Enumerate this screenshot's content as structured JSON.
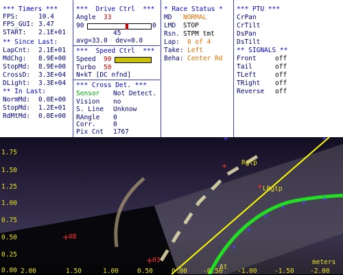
{
  "timers": {
    "header": "*** Timers ***",
    "rows": [
      {
        "label": "FPS:",
        "value": "10.4"
      },
      {
        "label": "FPS_GUI:",
        "value": "3.47"
      },
      {
        "label": "START:",
        "value": "2.1E+01"
      }
    ],
    "since_header": "** Since Last:",
    "since_rows": [
      {
        "label": "LapCnt:",
        "value": "2.1E+01"
      },
      {
        "label": "MdChg:",
        "value": "8.9E+00"
      },
      {
        "label": "StopMd:",
        "value": "8.9E+00"
      },
      {
        "label": "CrossD:",
        "value": "3.3E+04"
      },
      {
        "label": "DLight:",
        "value": "3.3E+04"
      }
    ],
    "in_header": "** In Last:",
    "in_rows": [
      {
        "label": "NormMd:",
        "value": "0.0E+00"
      },
      {
        "label": "StopMd:",
        "value": "1.2E+01"
      },
      {
        "label": "RdMtMd:",
        "value": "0.0E+00"
      }
    ]
  },
  "drive": {
    "header": "***  Drive Ctrl  ***",
    "angle_label": "Angle",
    "angle_value": "33",
    "slider_min": "90",
    "slider_max": "0",
    "slider_mid": "45",
    "slider_level": 0.63,
    "avg_text": "avg=33.0  dev=0.0",
    "speed_header": "***  Speed Ctrl  ***",
    "speed_label": "Speed",
    "speed_value": "90",
    "turbo_label": "Turbo",
    "turbo_value": "50",
    "speed_level": 1.0,
    "nkt_text": "N+kT [DC nfnd]",
    "cross_header": "*** Cross Det. ***",
    "cross_rows": [
      {
        "label": "Sensor",
        "value": "Not Detect."
      },
      {
        "label": "Vision",
        "value": "no"
      },
      {
        "label": "S. Line",
        "value": "Unknow"
      },
      {
        "label": "RAngle",
        "value": "0"
      },
      {
        "label": "Corr.",
        "value": "0"
      },
      {
        "label": "Pix Cnt",
        "value": "1767"
      }
    ]
  },
  "race": {
    "header": "* Race Status *",
    "rows": [
      {
        "label": "MD",
        "value": "NORMAL",
        "color": "orange"
      },
      {
        "label": "LMD",
        "value": "STOP",
        "color": "blk"
      },
      {
        "label": "Rsn.",
        "value": "STPM tmt",
        "color": "blk"
      },
      {
        "label": "Lap:",
        "value": "0 of 4",
        "color": "orange"
      },
      {
        "label": "Take:",
        "value": "Left",
        "color": "orange"
      },
      {
        "label": "Beha:",
        "value": "Center Rd",
        "color": "orange"
      }
    ]
  },
  "ptu": {
    "header": "*** PTU ***",
    "items": [
      "CrPan",
      "CrTilt",
      "DsPan",
      "DsTilt"
    ],
    "signals_header": "** SIGNALS **",
    "signals": [
      {
        "label": "Front",
        "value": "off"
      },
      {
        "label": "Tail",
        "value": "off"
      },
      {
        "label": "TLeft",
        "value": "off"
      },
      {
        "label": "TRight",
        "value": "off"
      },
      {
        "label": "Reverse",
        "value": "off"
      }
    ]
  },
  "camera": {
    "y_labels": [
      "1.75",
      "1.50",
      "1.25",
      "1.00",
      "0.75",
      "0.50",
      "0.25",
      "0.00"
    ],
    "x_labels": [
      "2.00",
      "1.50",
      "1.00",
      "0.50",
      "0.00",
      "-0.50",
      "-1.00",
      "-1.50",
      "-2.00"
    ],
    "axis_unit": "meters",
    "labels": {
      "rgtp": "Rgtp",
      "lrgtp": "LRgtp",
      "ob": "0B",
      "o3": "03",
      "at": "At"
    },
    "colors": {
      "overlay_text": "#e8e020",
      "guide_line": "#ffff00",
      "green_track": "#22dd22",
      "marker_blue": "#4444ff",
      "marker_red": "#ff3030"
    }
  }
}
